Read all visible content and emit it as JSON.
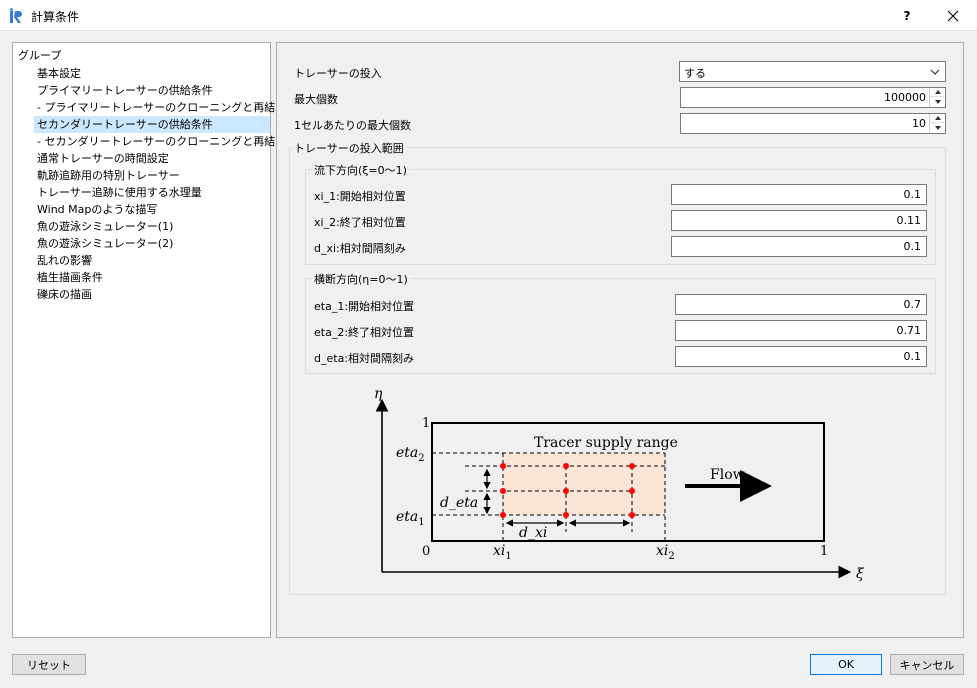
{
  "window": {
    "title": "計算条件",
    "help_label": "?",
    "close_label": "✕"
  },
  "tree": {
    "root": "グループ",
    "items": [
      {
        "label": "基本設定"
      },
      {
        "label": "プライマリートレーサーの供給条件"
      },
      {
        "label": "- プライマリートレーサーのクローニングと再結合"
      },
      {
        "label": "セカンダリートレーサーの供給条件"
      },
      {
        "label": "- セカンダリートレーサーのクローニングと再結合"
      },
      {
        "label": "通常トレーサーの時間設定"
      },
      {
        "label": "軌跡追跡用の特別トレーサー"
      },
      {
        "label": "トレーサー追跡に使用する水理量"
      },
      {
        "label": "Wind Mapのような描写"
      },
      {
        "label": "魚の遊泳シミュレーター(1)"
      },
      {
        "label": "魚の遊泳シミュレーター(2)"
      },
      {
        "label": "乱れの影響"
      },
      {
        "label": "植生描画条件"
      },
      {
        "label": "礫床の描画"
      }
    ],
    "selected_index": 3
  },
  "form": {
    "tracer_input": {
      "label": "トレーサーの投入",
      "value": "する"
    },
    "max_count": {
      "label": "最大個数",
      "value": "100000"
    },
    "max_per_cell": {
      "label": "1セルあたりの最大個数",
      "value": "10"
    },
    "range_group": {
      "title": "トレーサーの投入範囲"
    },
    "stream": {
      "title": "流下方向(ξ=0～1)",
      "xi_1": {
        "label": "xi_1:開始相対位置",
        "value": "0.1"
      },
      "xi_2": {
        "label": "xi_2:終了相対位置",
        "value": "0.11"
      },
      "d_xi": {
        "label": "d_xi:相対間隔刻み",
        "value": "0.1"
      }
    },
    "cross": {
      "title": "横断方向(η=0～1)",
      "eta_1": {
        "label": "eta_1:開始相対位置",
        "value": "0.7"
      },
      "eta_2": {
        "label": "eta_2:終了相対位置",
        "value": "0.71"
      },
      "d_eta": {
        "label": "d_eta:相対間隔刻み",
        "value": "0.1"
      }
    }
  },
  "diagram": {
    "eta_axis": "η",
    "xi_axis": "ξ",
    "one_top": "1",
    "zero": "0",
    "one_right": "1",
    "tracer_supply_range": "Tracer supply range",
    "flow": "Flow",
    "eta2": "eta",
    "eta2_sub": "2",
    "eta1": "eta",
    "eta1_sub": "1",
    "d_eta": "d_eta",
    "d_xi": "d_xi",
    "xi1": "xi",
    "xi1_sub": "1",
    "xi2": "xi",
    "xi2_sub": "2",
    "range_fill_color": "#fbe5d6",
    "point_color": "#ff0000"
  },
  "buttons": {
    "reset": "リセット",
    "ok": "OK",
    "cancel": "キャンセル"
  }
}
